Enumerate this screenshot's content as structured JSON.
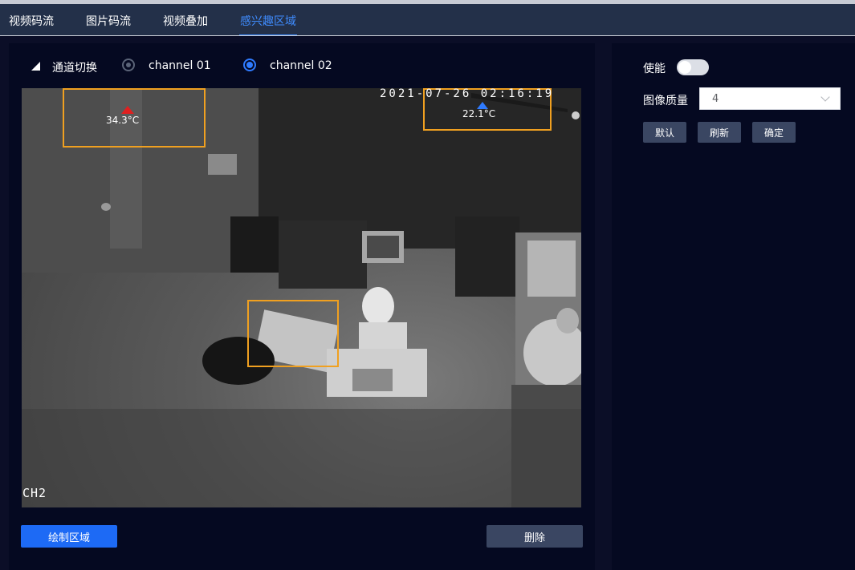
{
  "tabs": [
    {
      "label": "视频码流",
      "active": false
    },
    {
      "label": "图片码流",
      "active": false
    },
    {
      "label": "视频叠加",
      "active": false
    },
    {
      "label": "感兴趣区域",
      "active": true
    }
  ],
  "channel": {
    "switch_label": "通道切换",
    "options": [
      {
        "label": "channel 01",
        "selected": false
      },
      {
        "label": "channel 02",
        "selected": true
      }
    ]
  },
  "video": {
    "timestamp": "2021-07-26 02:16:19",
    "channel_osd": "CH2",
    "temps": {
      "max": "34.3°C",
      "min": "22.1°C"
    }
  },
  "actions": {
    "draw_area": "绘制区域",
    "delete": "删除"
  },
  "settings": {
    "enable_label": "使能",
    "enable_on": false,
    "quality_label": "图像质量",
    "quality_value": "4",
    "buttons": {
      "default": "默认",
      "refresh": "刷新",
      "confirm": "确定"
    }
  },
  "colors": {
    "accent": "#1d6af5",
    "roi": "#f0a020",
    "hot_marker": "#e02020",
    "cold_marker": "#2f7bff"
  }
}
